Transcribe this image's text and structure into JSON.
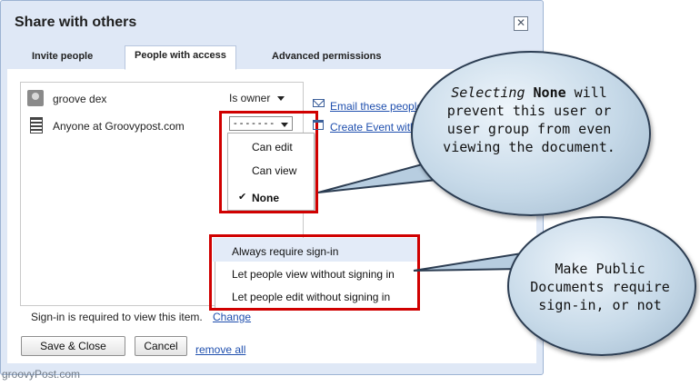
{
  "dialog": {
    "title": "Share with others",
    "close_glyph": "✕",
    "tabs": [
      "Invite people",
      "People with access",
      "Advanced permissions"
    ],
    "active_tab": "People with access"
  },
  "people": [
    {
      "name": "groove dex",
      "permission": "Is owner",
      "icon": "user-avatar-icon"
    },
    {
      "name": "Anyone at Groovypost.com",
      "permission": "- - - - - - -",
      "icon": "building-icon"
    }
  ],
  "permission_menu": {
    "items": [
      "Can edit",
      "Can view",
      "None"
    ],
    "selected": "None",
    "check_glyph": "✔"
  },
  "side_links": {
    "email": "Email these people",
    "event": "Create Event with these people"
  },
  "signin_menu": {
    "items": [
      "Always require sign-in",
      "Let people view without signing in",
      "Let people edit without signing in"
    ]
  },
  "footer": {
    "status": "Sign-in is required to view this item.",
    "change_link": "Change",
    "save_button": "Save & Close",
    "cancel_button": "Cancel",
    "remove_all": "remove all"
  },
  "callouts": {
    "none": {
      "line1_em": "Selecting",
      "line1_bold": "None",
      "line1_rest": " will",
      "line2": "prevent this user or",
      "line3": "user group from even",
      "line4": "viewing the document."
    },
    "public": {
      "line1": "Make Public",
      "line2": "Documents require",
      "line3": "sign-in, or not"
    }
  },
  "watermark": "groovyPost.com",
  "colors": {
    "highlight": "#d00000",
    "dialog_bg": "#dfe8f6",
    "link": "#1f4fae"
  }
}
